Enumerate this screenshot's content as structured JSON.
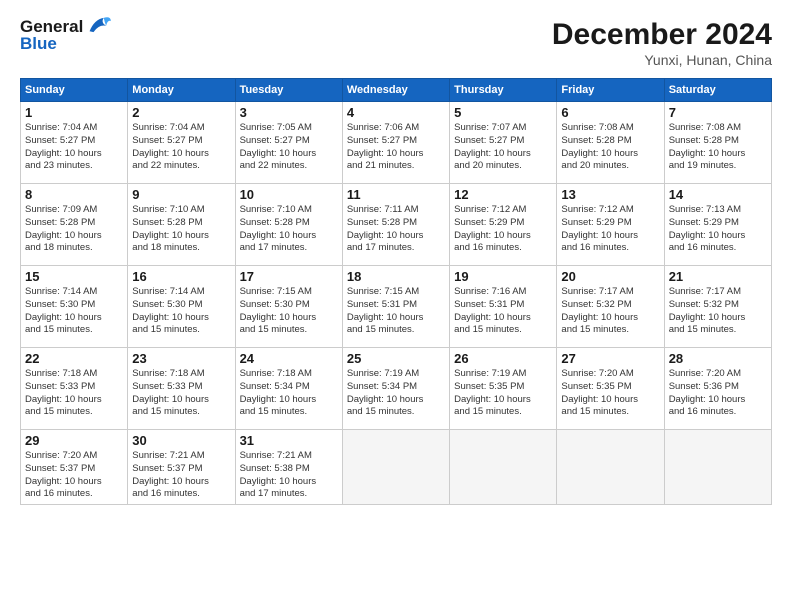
{
  "header": {
    "logo_line1": "General",
    "logo_line2": "Blue",
    "month_title": "December 2024",
    "location": "Yunxi, Hunan, China"
  },
  "weekdays": [
    "Sunday",
    "Monday",
    "Tuesday",
    "Wednesday",
    "Thursday",
    "Friday",
    "Saturday"
  ],
  "weeks": [
    [
      {
        "day": "1",
        "info": "Sunrise: 7:04 AM\nSunset: 5:27 PM\nDaylight: 10 hours\nand 23 minutes."
      },
      {
        "day": "2",
        "info": "Sunrise: 7:04 AM\nSunset: 5:27 PM\nDaylight: 10 hours\nand 22 minutes."
      },
      {
        "day": "3",
        "info": "Sunrise: 7:05 AM\nSunset: 5:27 PM\nDaylight: 10 hours\nand 22 minutes."
      },
      {
        "day": "4",
        "info": "Sunrise: 7:06 AM\nSunset: 5:27 PM\nDaylight: 10 hours\nand 21 minutes."
      },
      {
        "day": "5",
        "info": "Sunrise: 7:07 AM\nSunset: 5:27 PM\nDaylight: 10 hours\nand 20 minutes."
      },
      {
        "day": "6",
        "info": "Sunrise: 7:08 AM\nSunset: 5:28 PM\nDaylight: 10 hours\nand 20 minutes."
      },
      {
        "day": "7",
        "info": "Sunrise: 7:08 AM\nSunset: 5:28 PM\nDaylight: 10 hours\nand 19 minutes."
      }
    ],
    [
      {
        "day": "8",
        "info": "Sunrise: 7:09 AM\nSunset: 5:28 PM\nDaylight: 10 hours\nand 18 minutes."
      },
      {
        "day": "9",
        "info": "Sunrise: 7:10 AM\nSunset: 5:28 PM\nDaylight: 10 hours\nand 18 minutes."
      },
      {
        "day": "10",
        "info": "Sunrise: 7:10 AM\nSunset: 5:28 PM\nDaylight: 10 hours\nand 17 minutes."
      },
      {
        "day": "11",
        "info": "Sunrise: 7:11 AM\nSunset: 5:28 PM\nDaylight: 10 hours\nand 17 minutes."
      },
      {
        "day": "12",
        "info": "Sunrise: 7:12 AM\nSunset: 5:29 PM\nDaylight: 10 hours\nand 16 minutes."
      },
      {
        "day": "13",
        "info": "Sunrise: 7:12 AM\nSunset: 5:29 PM\nDaylight: 10 hours\nand 16 minutes."
      },
      {
        "day": "14",
        "info": "Sunrise: 7:13 AM\nSunset: 5:29 PM\nDaylight: 10 hours\nand 16 minutes."
      }
    ],
    [
      {
        "day": "15",
        "info": "Sunrise: 7:14 AM\nSunset: 5:30 PM\nDaylight: 10 hours\nand 15 minutes."
      },
      {
        "day": "16",
        "info": "Sunrise: 7:14 AM\nSunset: 5:30 PM\nDaylight: 10 hours\nand 15 minutes."
      },
      {
        "day": "17",
        "info": "Sunrise: 7:15 AM\nSunset: 5:30 PM\nDaylight: 10 hours\nand 15 minutes."
      },
      {
        "day": "18",
        "info": "Sunrise: 7:15 AM\nSunset: 5:31 PM\nDaylight: 10 hours\nand 15 minutes."
      },
      {
        "day": "19",
        "info": "Sunrise: 7:16 AM\nSunset: 5:31 PM\nDaylight: 10 hours\nand 15 minutes."
      },
      {
        "day": "20",
        "info": "Sunrise: 7:17 AM\nSunset: 5:32 PM\nDaylight: 10 hours\nand 15 minutes."
      },
      {
        "day": "21",
        "info": "Sunrise: 7:17 AM\nSunset: 5:32 PM\nDaylight: 10 hours\nand 15 minutes."
      }
    ],
    [
      {
        "day": "22",
        "info": "Sunrise: 7:18 AM\nSunset: 5:33 PM\nDaylight: 10 hours\nand 15 minutes."
      },
      {
        "day": "23",
        "info": "Sunrise: 7:18 AM\nSunset: 5:33 PM\nDaylight: 10 hours\nand 15 minutes."
      },
      {
        "day": "24",
        "info": "Sunrise: 7:18 AM\nSunset: 5:34 PM\nDaylight: 10 hours\nand 15 minutes."
      },
      {
        "day": "25",
        "info": "Sunrise: 7:19 AM\nSunset: 5:34 PM\nDaylight: 10 hours\nand 15 minutes."
      },
      {
        "day": "26",
        "info": "Sunrise: 7:19 AM\nSunset: 5:35 PM\nDaylight: 10 hours\nand 15 minutes."
      },
      {
        "day": "27",
        "info": "Sunrise: 7:20 AM\nSunset: 5:35 PM\nDaylight: 10 hours\nand 15 minutes."
      },
      {
        "day": "28",
        "info": "Sunrise: 7:20 AM\nSunset: 5:36 PM\nDaylight: 10 hours\nand 16 minutes."
      }
    ],
    [
      {
        "day": "29",
        "info": "Sunrise: 7:20 AM\nSunset: 5:37 PM\nDaylight: 10 hours\nand 16 minutes."
      },
      {
        "day": "30",
        "info": "Sunrise: 7:21 AM\nSunset: 5:37 PM\nDaylight: 10 hours\nand 16 minutes."
      },
      {
        "day": "31",
        "info": "Sunrise: 7:21 AM\nSunset: 5:38 PM\nDaylight: 10 hours\nand 17 minutes."
      },
      {
        "day": "",
        "info": ""
      },
      {
        "day": "",
        "info": ""
      },
      {
        "day": "",
        "info": ""
      },
      {
        "day": "",
        "info": ""
      }
    ]
  ]
}
